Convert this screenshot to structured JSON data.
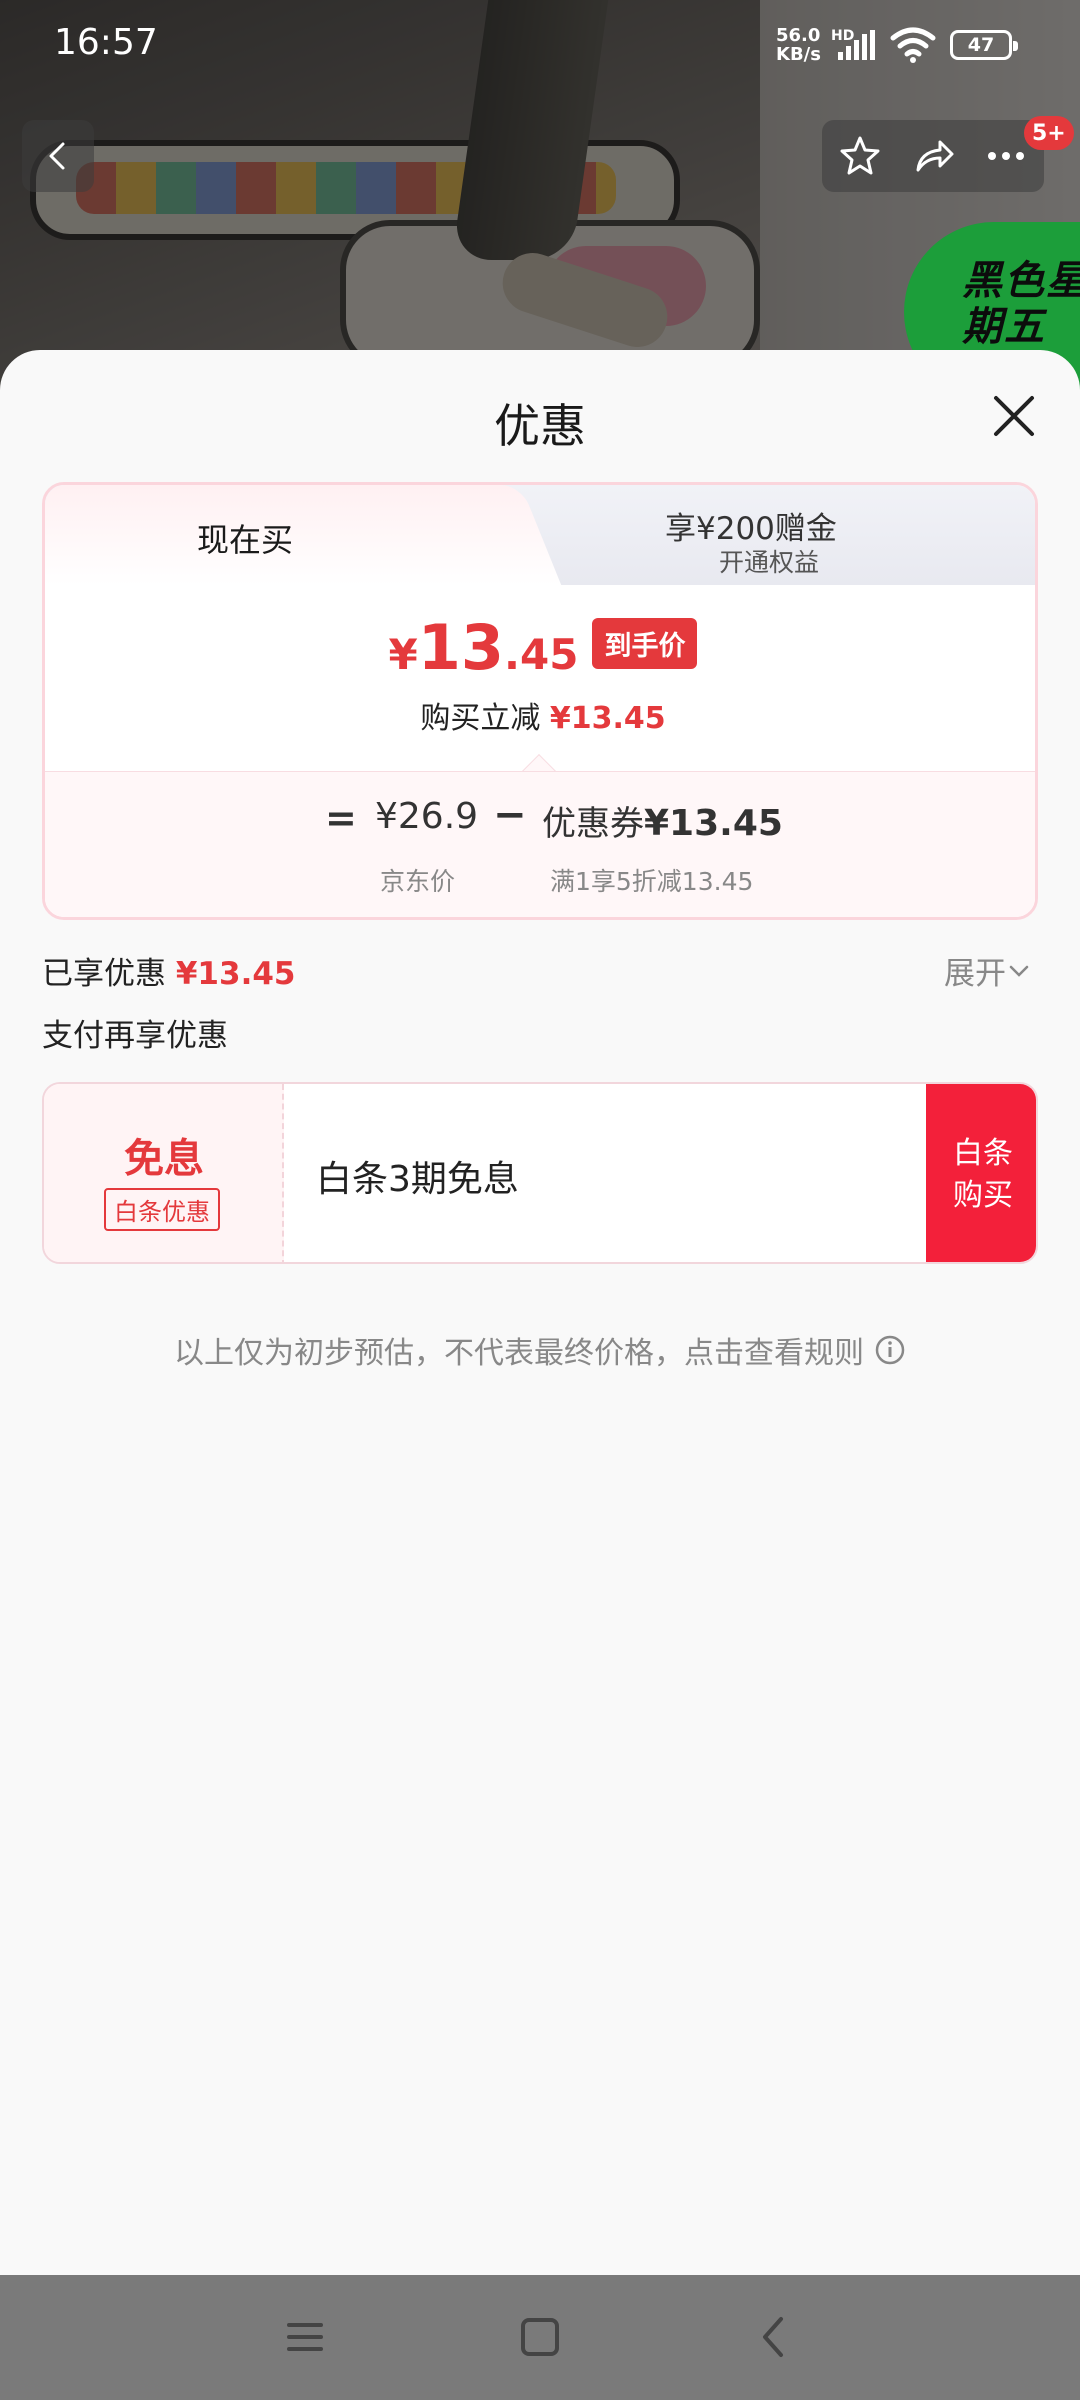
{
  "status_bar": {
    "time": "16:57",
    "network_speed_value": "56.0",
    "network_speed_unit": "KB/s",
    "hd": "HD",
    "battery": "47"
  },
  "top_nav": {
    "badge": "5+",
    "promo_text": "黑色星期五"
  },
  "sheet": {
    "title": "优惠",
    "tabs": {
      "active": "现在买",
      "inactive_title": "享¥200赠金",
      "inactive_subtitle": "开通权益"
    },
    "price": {
      "currency": "¥",
      "integer": "13",
      "decimal": ".45",
      "tag": "到手价"
    },
    "reduce": {
      "label": "购买立减",
      "amount": "¥13.45"
    },
    "breakdown": {
      "equals": "=",
      "jd_price": "¥26.9",
      "minus": "−",
      "coupon_label": "优惠券",
      "coupon_amount": "¥13.45",
      "jd_price_label": "京东价",
      "coupon_desc": "满1享5折减13.45"
    },
    "enjoyed": {
      "label": "已享优惠",
      "amount": "¥13.45",
      "expand": "展开"
    },
    "pay_section_title": "支付再享优惠",
    "pay_option": {
      "big": "免息",
      "tag": "白条优惠",
      "desc": "白条3期免息",
      "action_line1": "白条",
      "action_line2": "购买"
    },
    "disclaimer": "以上仅为初步预估，不代表最终价格，点击查看规则"
  },
  "colors": {
    "accent_red": "#e4393c",
    "pay_button": "#f3203a",
    "promo_green": "#1c9e3a"
  }
}
